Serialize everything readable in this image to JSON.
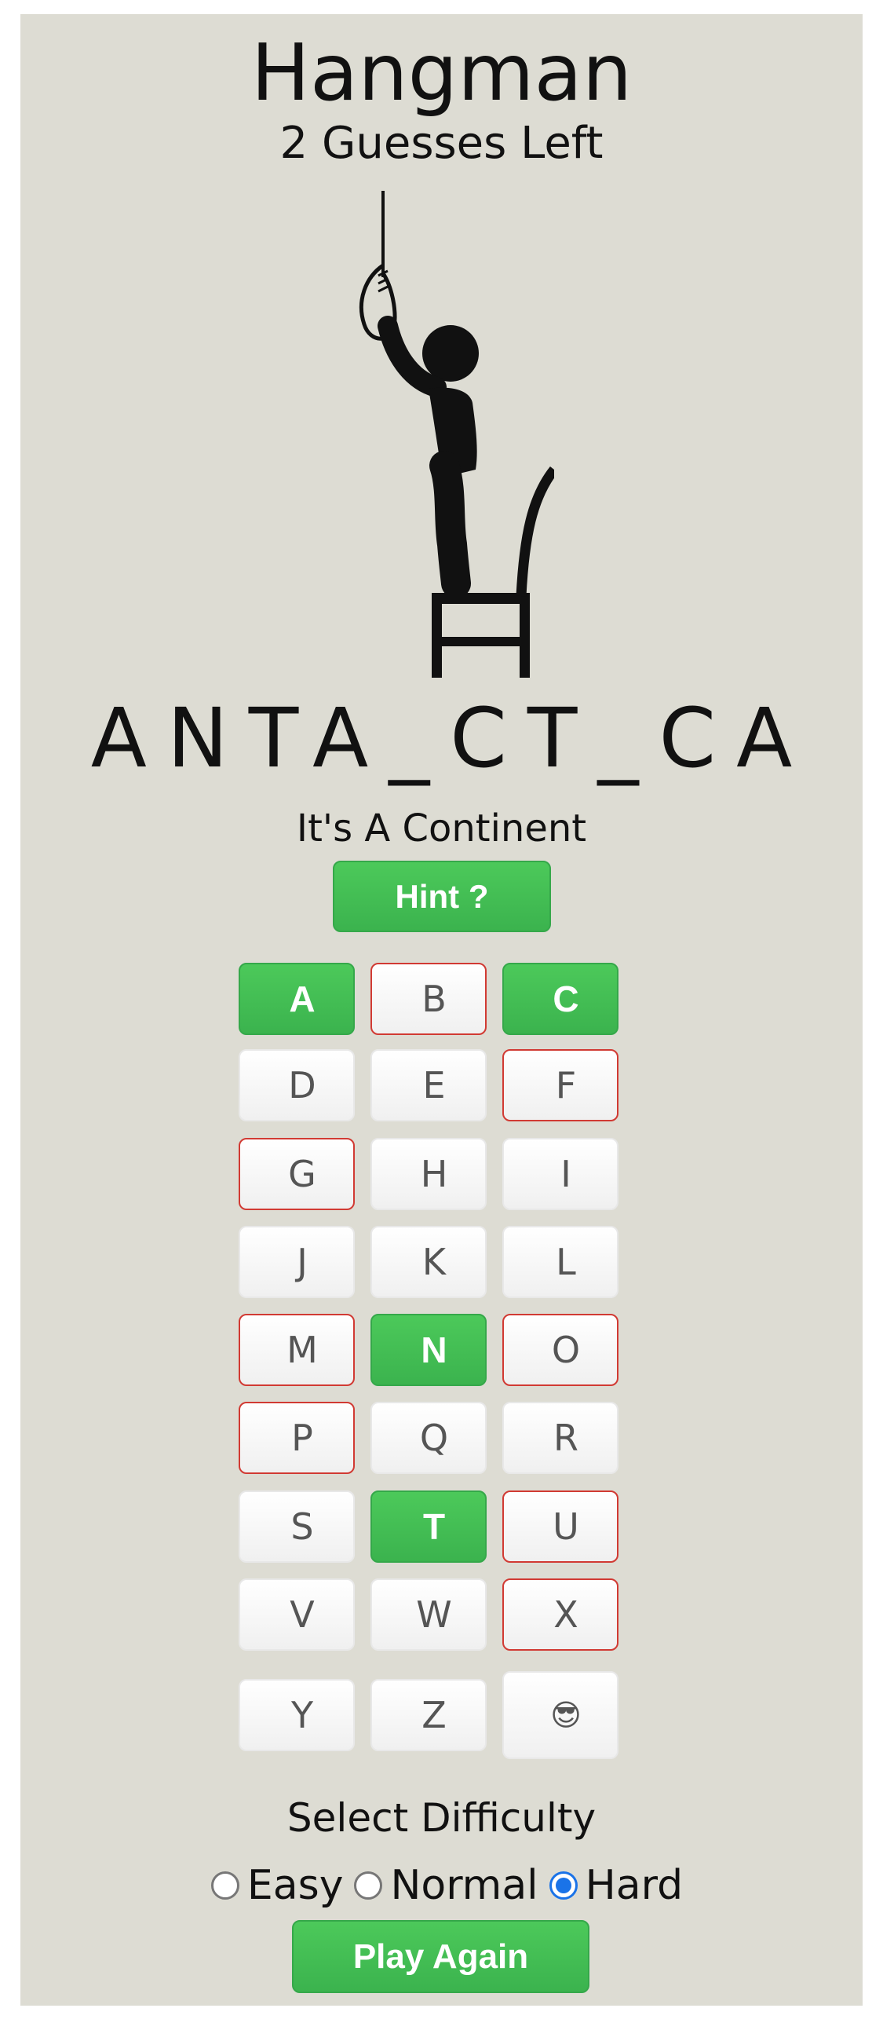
{
  "header": {
    "title": "Hangman",
    "guesses_left": "2 Guesses Left"
  },
  "puzzle": {
    "word_display": "ANTA_CT_CA",
    "clue": "It's A Continent"
  },
  "hint_button": "Hint ?",
  "keys": [
    {
      "label": "A",
      "state": "correct"
    },
    {
      "label": "B",
      "state": "wrong"
    },
    {
      "label": "C",
      "state": "correct"
    },
    {
      "label": "D",
      "state": "unused"
    },
    {
      "label": "E",
      "state": "unused"
    },
    {
      "label": "F",
      "state": "wrong"
    },
    {
      "label": "G",
      "state": "wrong"
    },
    {
      "label": "H",
      "state": "unused"
    },
    {
      "label": "I",
      "state": "unused"
    },
    {
      "label": "J",
      "state": "unused"
    },
    {
      "label": "K",
      "state": "unused"
    },
    {
      "label": "L",
      "state": "unused"
    },
    {
      "label": "M",
      "state": "wrong"
    },
    {
      "label": "N",
      "state": "correct"
    },
    {
      "label": "O",
      "state": "wrong"
    },
    {
      "label": "P",
      "state": "wrong"
    },
    {
      "label": "Q",
      "state": "unused"
    },
    {
      "label": "R",
      "state": "unused"
    },
    {
      "label": "S",
      "state": "unused"
    },
    {
      "label": "T",
      "state": "correct"
    },
    {
      "label": "U",
      "state": "wrong"
    },
    {
      "label": "V",
      "state": "unused"
    },
    {
      "label": "W",
      "state": "unused"
    },
    {
      "label": "X",
      "state": "wrong"
    },
    {
      "label": "Y",
      "state": "unused"
    },
    {
      "label": "Z",
      "state": "unused"
    },
    {
      "label": "😎",
      "state": "unused"
    }
  ],
  "difficulty": {
    "label": "Select Difficulty",
    "options": [
      "Easy",
      "Normal",
      "Hard"
    ],
    "selected": "Hard"
  },
  "play_again_button": "Play Again",
  "colors": {
    "correct": "#3bb34e",
    "wrong": "#d13a33",
    "background": "#dddcd3"
  }
}
